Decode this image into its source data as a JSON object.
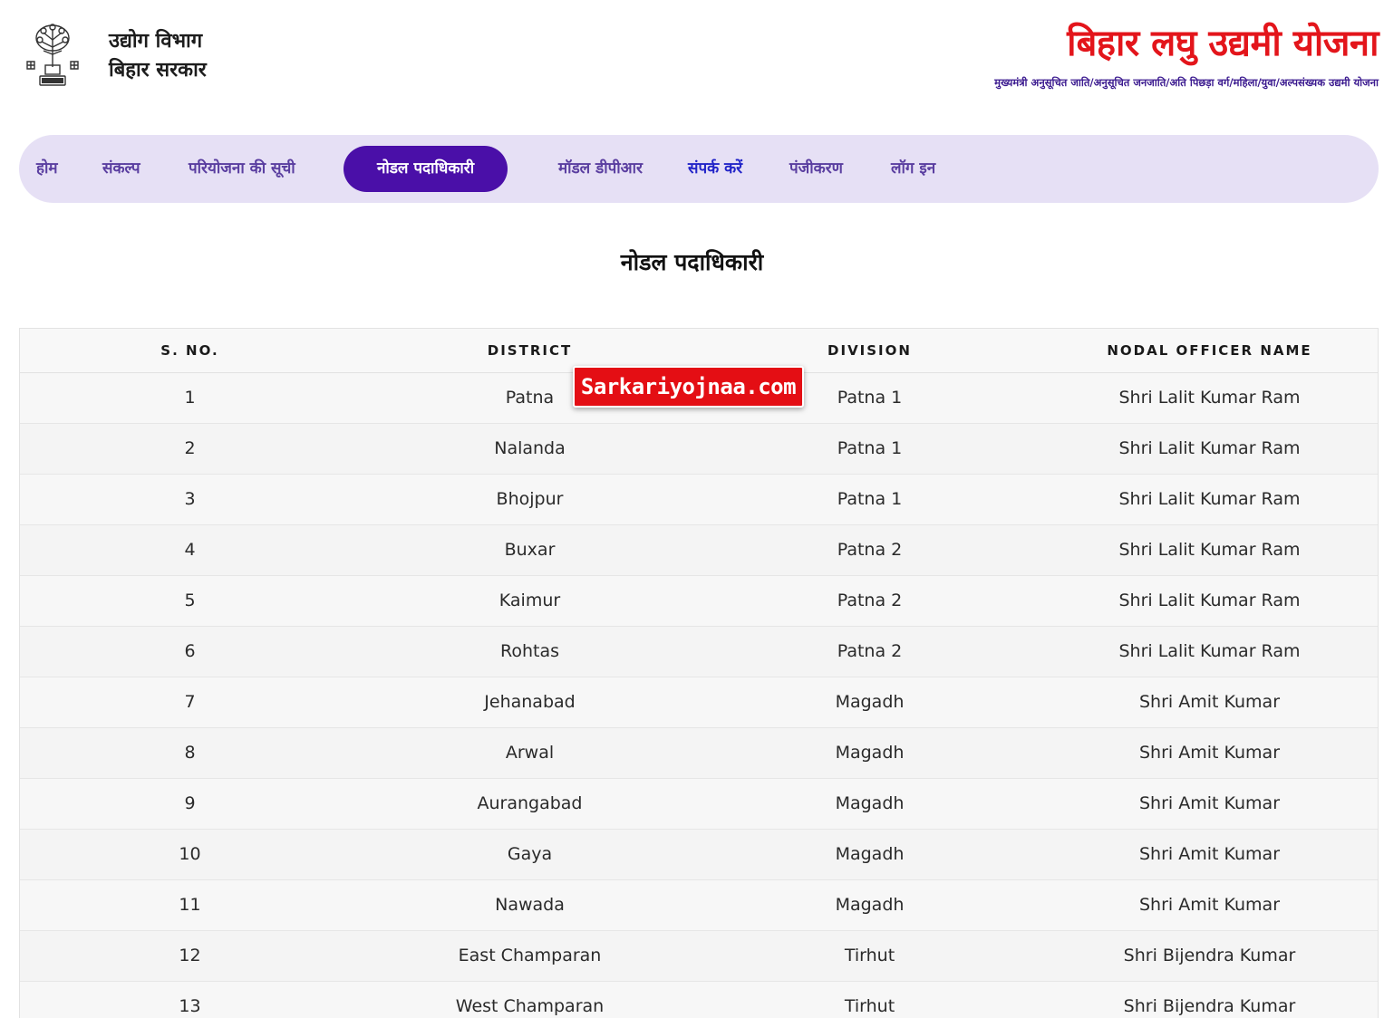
{
  "header": {
    "dept_line1": "उद्योग विभाग",
    "dept_line2": "बिहार सरकार",
    "emblem_icon": "bihar-emblem-icon",
    "title": "बिहार लघु उद्यमी योजना",
    "subtitle": "मुख्यमंत्री अनुसूचित जाति/अनुसूचित जनजाति/अति पिछड़ा वर्ग/महिला/युवा/अल्पसंख्यक उद्यमी योजना"
  },
  "nav": {
    "items": [
      {
        "label": "होम"
      },
      {
        "label": "संकल्प"
      },
      {
        "label": "परियोजना की सूची"
      },
      {
        "label": "नोडल पदाधिकारी",
        "active": true
      },
      {
        "label": "मॉडल डीपीआर"
      },
      {
        "label": "संपर्क करें"
      },
      {
        "label": "पंजीकरण"
      },
      {
        "label": "लॉग इन"
      }
    ]
  },
  "page": {
    "title": "नोडल पदाधिकारी"
  },
  "table": {
    "headers": [
      "S. NO.",
      "DISTRICT",
      "DIVISION",
      "NODAL OFFICER NAME"
    ],
    "rows": [
      [
        "1",
        "Patna",
        "Patna 1",
        "Shri Lalit Kumar Ram"
      ],
      [
        "2",
        "Nalanda",
        "Patna 1",
        "Shri Lalit Kumar Ram"
      ],
      [
        "3",
        "Bhojpur",
        "Patna 1",
        "Shri Lalit Kumar Ram"
      ],
      [
        "4",
        "Buxar",
        "Patna 2",
        "Shri Lalit Kumar Ram"
      ],
      [
        "5",
        "Kaimur",
        "Patna 2",
        "Shri Lalit Kumar Ram"
      ],
      [
        "6",
        "Rohtas",
        "Patna 2",
        "Shri Lalit Kumar Ram"
      ],
      [
        "7",
        "Jehanabad",
        "Magadh",
        "Shri Amit Kumar"
      ],
      [
        "8",
        "Arwal",
        "Magadh",
        "Shri Amit Kumar"
      ],
      [
        "9",
        "Aurangabad",
        "Magadh",
        "Shri Amit Kumar"
      ],
      [
        "10",
        "Gaya",
        "Magadh",
        "Shri Amit Kumar"
      ],
      [
        "11",
        "Nawada",
        "Magadh",
        "Shri Amit Kumar"
      ],
      [
        "12",
        "East Champaran",
        "Tirhut",
        "Shri Bijendra Kumar"
      ],
      [
        "13",
        "West Champaran",
        "Tirhut",
        "Shri Bijendra Kumar"
      ]
    ]
  },
  "watermark": {
    "text": "Sarkariyojnaa.com"
  },
  "colors": {
    "brand_red": "#e3151b",
    "nav_bg": "#e6e0f5",
    "nav_active": "#4a0fa8",
    "nav_text": "#5a3ea0",
    "subtitle": "#3b1a8f"
  }
}
